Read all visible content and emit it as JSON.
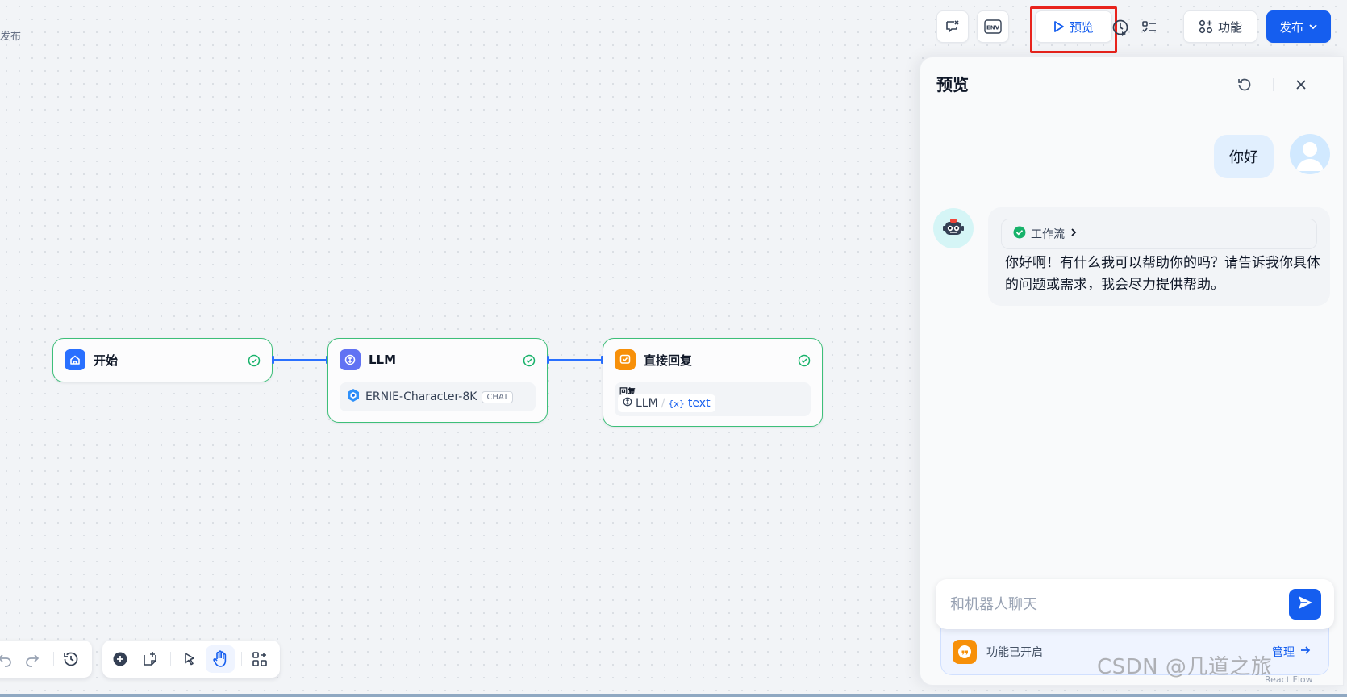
{
  "breadcrumb": "发布",
  "toolbar": {
    "preview_label": "预览",
    "features_label": "功能",
    "publish_label": "发布"
  },
  "nodes": {
    "start": {
      "title": "开始"
    },
    "llm": {
      "title": "LLM",
      "model": "ERNIE-Character-8K",
      "model_tag": "CHAT"
    },
    "reply": {
      "title": "直接回复",
      "field_label": "回复",
      "source_node": "LLM",
      "separator": "/",
      "var_prefix": "{x}",
      "var_name": "text"
    }
  },
  "panel": {
    "title": "预览",
    "user_message": "你好",
    "workflow_label": "工作流",
    "bot_message": "你好啊！有什么我可以帮助你的吗？请告诉我你具体的问题或需求，我会尽力提供帮助。",
    "input_placeholder": "和机器人聊天",
    "feature_status": "功能已开启",
    "manage_label": "管理"
  },
  "watermark": "CSDN @几道之旅",
  "reactflow_label": "React Flow",
  "colors": {
    "accent": "#155eef",
    "node_border": "#3dbf79",
    "edge": "#2970ff",
    "highlight": "#e8231c"
  }
}
